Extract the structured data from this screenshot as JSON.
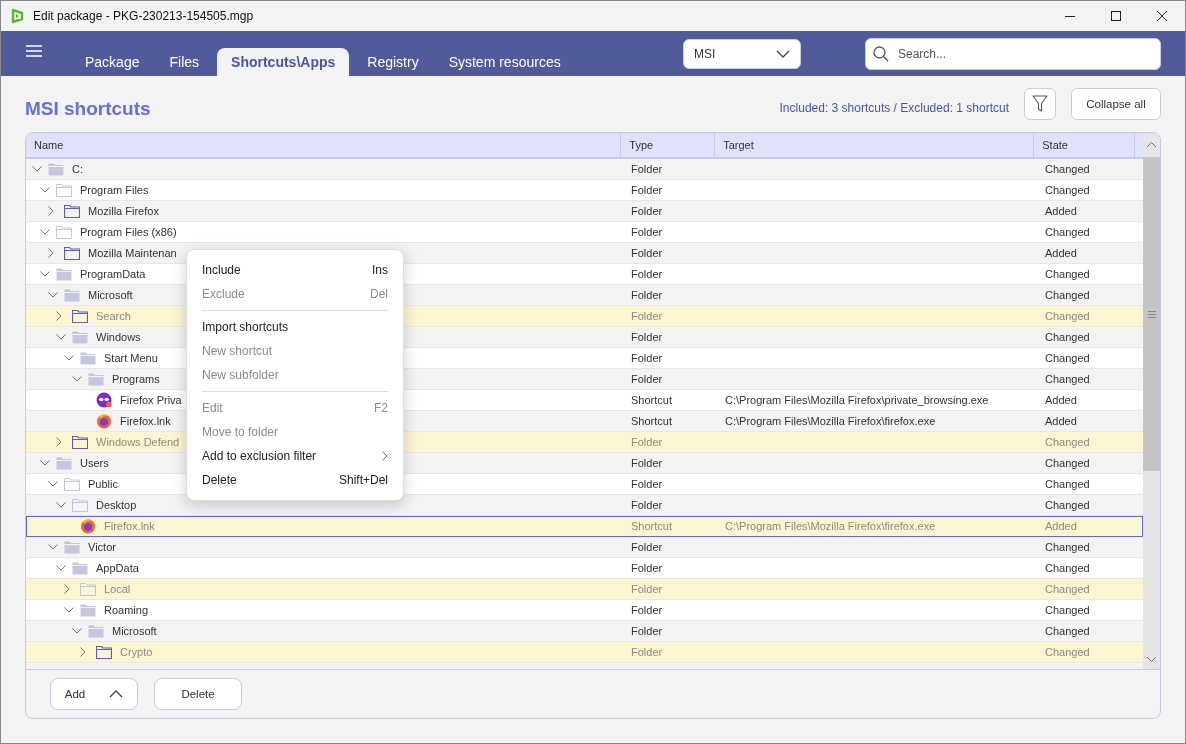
{
  "window": {
    "title": "Edit package - PKG-230213-154505.mgp"
  },
  "tabs": [
    {
      "label": "Package",
      "selected": false
    },
    {
      "label": "Files",
      "selected": false
    },
    {
      "label": "Shortcuts\\Apps",
      "selected": true
    },
    {
      "label": "Registry",
      "selected": false
    },
    {
      "label": "System resources",
      "selected": false
    }
  ],
  "type_dropdown": {
    "value": "MSI"
  },
  "search": {
    "placeholder": "Search..."
  },
  "section": {
    "title": "MSI shortcuts",
    "summary": "Included: 3 shortcuts / Excluded: 1 shortcut",
    "collapse_button": "Collapse all"
  },
  "table": {
    "columns": [
      "Name",
      "Type",
      "Target",
      "State"
    ],
    "rows": [
      {
        "name": "C:",
        "kind": "filled",
        "expanded": true,
        "excluded": false,
        "selected": false,
        "type": "Folder",
        "state": "Changed",
        "children": [
          {
            "name": "Program Files",
            "kind": "empty",
            "expanded": true,
            "excluded": false,
            "selected": false,
            "type": "Folder",
            "state": "Changed",
            "children": [
              {
                "name": "Mozilla Firefox",
                "kind": "new",
                "expanded": false,
                "excluded": false,
                "selected": false,
                "type": "Folder",
                "state": "Added"
              }
            ]
          },
          {
            "name": "Program Files (x86)",
            "kind": "empty",
            "expanded": true,
            "excluded": false,
            "selected": false,
            "type": "Folder",
            "state": "Changed",
            "children": [
              {
                "name": "Mozilla Maintenan",
                "kind": "new",
                "expanded": false,
                "excluded": false,
                "selected": false,
                "type": "Folder",
                "state": "Added"
              }
            ]
          },
          {
            "name": "ProgramData",
            "kind": "filled",
            "expanded": true,
            "excluded": false,
            "selected": false,
            "type": "Folder",
            "state": "Changed",
            "children": [
              {
                "name": "Microsoft",
                "kind": "filled",
                "expanded": true,
                "excluded": false,
                "selected": false,
                "type": "Folder",
                "state": "Changed",
                "children": [
                  {
                    "name": "Search",
                    "kind": "new",
                    "expanded": false,
                    "excluded": true,
                    "selected": false,
                    "type": "Folder",
                    "state": "Changed"
                  },
                  {
                    "name": "Windows",
                    "kind": "filled",
                    "expanded": true,
                    "excluded": false,
                    "selected": false,
                    "type": "Folder",
                    "state": "Changed",
                    "children": [
                      {
                        "name": "Start Menu",
                        "kind": "filled",
                        "expanded": true,
                        "excluded": false,
                        "selected": false,
                        "type": "Folder",
                        "state": "Changed",
                        "children": [
                          {
                            "name": "Programs",
                            "kind": "filled",
                            "expanded": true,
                            "excluded": false,
                            "selected": false,
                            "type": "Folder",
                            "state": "Changed",
                            "children": [
                              {
                                "name": "Firefox Priva",
                                "kind": "private",
                                "excluded": false,
                                "selected": false,
                                "type": "Shortcut",
                                "target": "C:\\Program Files\\Mozilla Firefox\\private_browsing.exe",
                                "state": "Added"
                              },
                              {
                                "name": "Firefox.lnk",
                                "kind": "firefox",
                                "excluded": false,
                                "selected": false,
                                "type": "Shortcut",
                                "target": "C:\\Program Files\\Mozilla Firefox\\firefox.exe",
                                "state": "Added"
                              }
                            ]
                          }
                        ]
                      }
                    ]
                  },
                  {
                    "name": "Windows Defend",
                    "kind": "new",
                    "expanded": false,
                    "excluded": true,
                    "selected": false,
                    "type": "Folder",
                    "state": "Changed"
                  }
                ]
              }
            ]
          },
          {
            "name": "Users",
            "kind": "filled",
            "expanded": true,
            "excluded": false,
            "selected": false,
            "type": "Folder",
            "state": "Changed",
            "children": [
              {
                "name": "Public",
                "kind": "empty",
                "expanded": true,
                "excluded": false,
                "selected": false,
                "type": "Folder",
                "state": "Changed",
                "children": [
                  {
                    "name": "Desktop",
                    "kind": "empty",
                    "expanded": true,
                    "excluded": false,
                    "selected": false,
                    "type": "Folder",
                    "state": "Changed",
                    "children": [
                      {
                        "name": "Firefox.lnk",
                        "kind": "firefox",
                        "excluded": true,
                        "selected": true,
                        "type": "Shortcut",
                        "target": "C:\\Program Files\\Mozilla Firefox\\firefox.exe",
                        "state": "Added"
                      }
                    ]
                  }
                ]
              },
              {
                "name": "Victor",
                "kind": "filled",
                "expanded": true,
                "excluded": false,
                "selected": false,
                "type": "Folder",
                "state": "Changed",
                "children": [
                  {
                    "name": "AppData",
                    "kind": "filled",
                    "expanded": true,
                    "excluded": false,
                    "selected": false,
                    "type": "Folder",
                    "state": "Changed",
                    "children": [
                      {
                        "name": "Local",
                        "kind": "empty",
                        "expanded": false,
                        "excluded": true,
                        "selected": false,
                        "type": "Folder",
                        "state": "Changed"
                      },
                      {
                        "name": "Roaming",
                        "kind": "filled",
                        "expanded": true,
                        "excluded": false,
                        "selected": false,
                        "type": "Folder",
                        "state": "Changed",
                        "children": [
                          {
                            "name": "Microsoft",
                            "kind": "filled",
                            "expanded": true,
                            "excluded": false,
                            "selected": false,
                            "type": "Folder",
                            "state": "Changed",
                            "children": [
                              {
                                "name": "Crypto",
                                "kind": "new",
                                "expanded": false,
                                "excluded": true,
                                "selected": false,
                                "type": "Folder",
                                "state": "Changed"
                              }
                            ]
                          }
                        ]
                      }
                    ]
                  }
                ]
              }
            ]
          }
        ]
      }
    ]
  },
  "context_menu": {
    "groups": [
      [
        {
          "label": "Include",
          "shortcut": "Ins",
          "disabled": false,
          "submenu": false
        },
        {
          "label": "Exclude",
          "shortcut": "Del",
          "disabled": true,
          "submenu": false
        }
      ],
      [
        {
          "label": "Import shortcuts",
          "disabled": false,
          "submenu": false
        },
        {
          "label": "New shortcut",
          "disabled": true,
          "submenu": false
        },
        {
          "label": "New subfolder",
          "disabled": true,
          "submenu": false
        }
      ],
      [
        {
          "label": "Edit",
          "shortcut": "F2",
          "disabled": true,
          "submenu": false
        },
        {
          "label": "Move to folder",
          "disabled": true,
          "submenu": false
        },
        {
          "label": "Add to exclusion filter",
          "disabled": false,
          "submenu": true
        },
        {
          "label": "Delete",
          "shortcut": "Shift+Del",
          "disabled": false,
          "submenu": false
        }
      ]
    ]
  },
  "footer_buttons": [
    {
      "label": "Add",
      "kind": "dropup"
    },
    {
      "label": "Delete",
      "kind": "plain"
    }
  ]
}
